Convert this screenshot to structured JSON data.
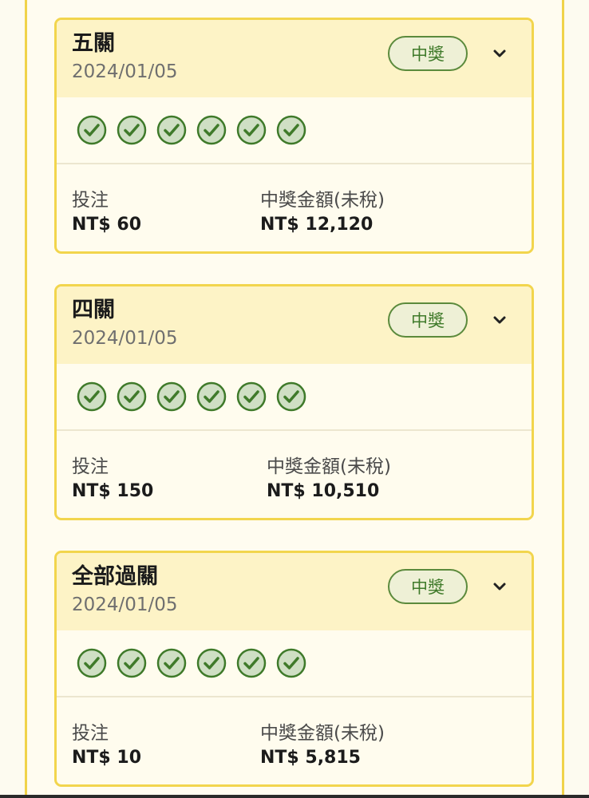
{
  "colors": {
    "card_border": "#f2d54d",
    "card_header_bg": "#fdf3c6",
    "card_body_bg": "#fffcee",
    "check_green": "#3f7a2a",
    "check_fill": "#cfdfc4"
  },
  "labels": {
    "bet": "投注",
    "prize": "中獎金額(未稅)"
  },
  "cards": [
    {
      "title": "五關",
      "date": "2024/01/05",
      "status": "中獎",
      "check_count": 6,
      "bet_amount": "NT$ 60",
      "prize_amount": "NT$ 12,120",
      "icons": {
        "expand": "chevron-down-icon",
        "leg": "check-circle-icon"
      }
    },
    {
      "title": "四關",
      "date": "2024/01/05",
      "status": "中獎",
      "check_count": 6,
      "bet_amount": "NT$ 150",
      "prize_amount": "NT$ 10,510",
      "icons": {
        "expand": "chevron-down-icon",
        "leg": "check-circle-icon"
      }
    },
    {
      "title": "全部過關",
      "date": "2024/01/05",
      "status": "中獎",
      "check_count": 6,
      "bet_amount": "NT$ 10",
      "prize_amount": "NT$ 5,815",
      "icons": {
        "expand": "chevron-down-icon",
        "leg": "check-circle-icon"
      }
    }
  ]
}
